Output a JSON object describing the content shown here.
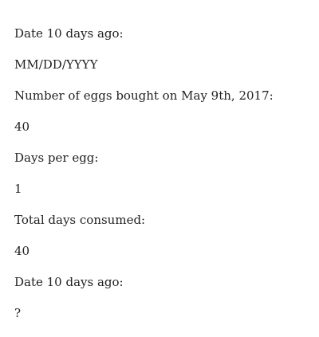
{
  "lines": [
    {
      "text": "Date 10 days ago:"
    },
    {
      "text": "MM/DD/YYYY"
    },
    {
      "text": "Number of eggs bought on May 9th, 2017:"
    },
    {
      "text": "40"
    },
    {
      "text": "Days per egg:"
    },
    {
      "text": "1"
    },
    {
      "text": "Total days consumed:"
    },
    {
      "text": "40"
    },
    {
      "text": "Date 10 days ago:"
    },
    {
      "text": "?"
    }
  ]
}
